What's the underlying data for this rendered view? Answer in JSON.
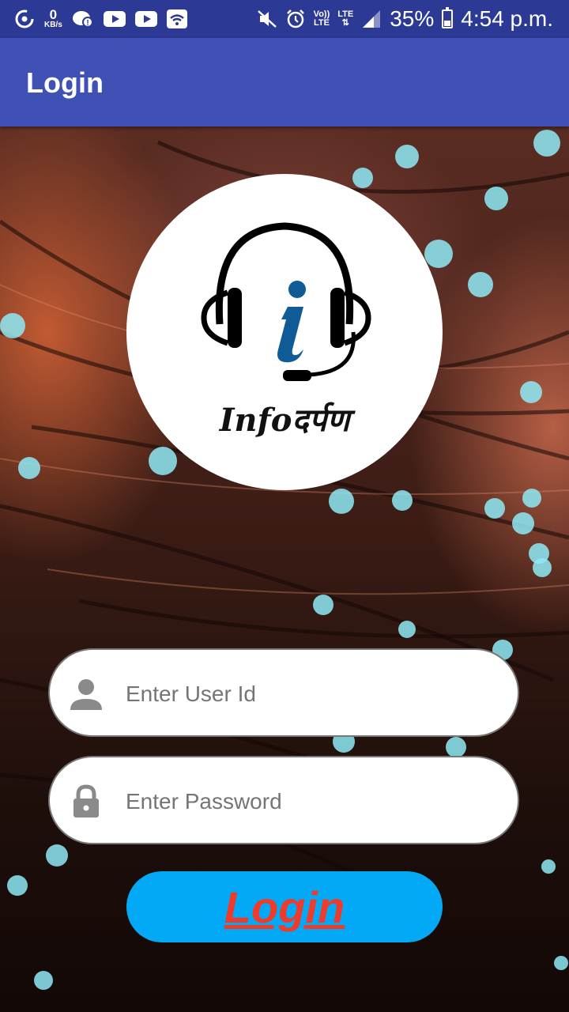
{
  "status_bar": {
    "kbs_value": "0",
    "kbs_unit": "KB/s",
    "volte_top": "Vo))",
    "volte_bottom": "LTE",
    "lte_label": "LTE",
    "battery": "35%",
    "time": "4:54 p.m."
  },
  "app_bar": {
    "title": "Login"
  },
  "logo": {
    "text": "Infoदर्पण"
  },
  "form": {
    "user_placeholder": "Enter User Id",
    "password_placeholder": "Enter Password",
    "login_label": "Login"
  },
  "colors": {
    "status_bar": "#2c3a95",
    "app_bar": "#3f51b5",
    "button": "#03a9f4",
    "button_text": "#ef3b2c",
    "logo_blue": "#0e5b96"
  }
}
